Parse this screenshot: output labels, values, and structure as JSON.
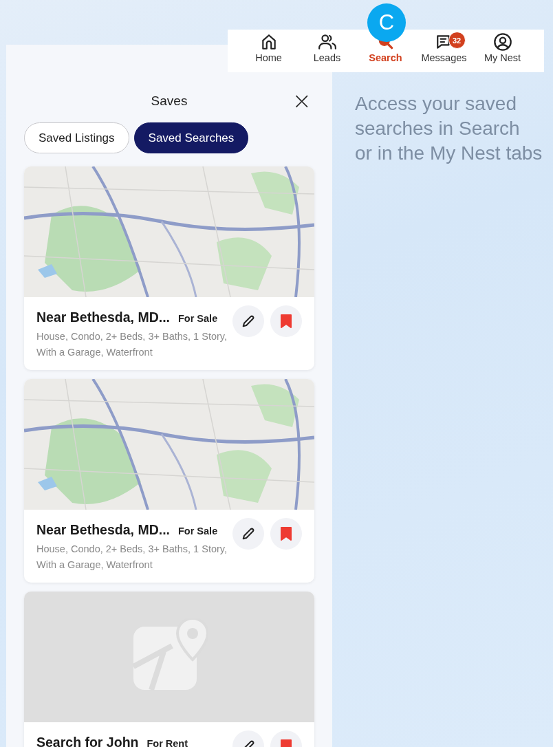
{
  "nav": {
    "items": [
      {
        "label": "Home",
        "selected": false
      },
      {
        "label": "Leads",
        "selected": false
      },
      {
        "label": "Search",
        "selected": true
      },
      {
        "label": "Messages",
        "selected": false,
        "badge": "32"
      },
      {
        "label": "My Nest",
        "selected": false
      }
    ]
  },
  "callout": {
    "marker": "C",
    "lines": [
      "Access your saved",
      "searches in Search",
      "or in the My Nest tabs"
    ]
  },
  "saves": {
    "title": "Saves",
    "close": "×",
    "tabs": [
      {
        "label": "Saved Listings",
        "selected": false
      },
      {
        "label": "Saved Searches",
        "selected": true
      }
    ],
    "cards": [
      {
        "kind": "map",
        "title": "Near Bethesda, MD...",
        "type": "For Sale",
        "description": "House, Condo, 2+ Beds, 3+ Baths, 1 Story, With a Garage, Waterfront",
        "saved": true
      },
      {
        "kind": "map",
        "title": "Near Bethesda, MD...",
        "type": "For Sale",
        "description": "House, Condo, 2+ Beds, 3+ Baths, 1 Story, With a Garage, Waterfront",
        "saved": true
      },
      {
        "kind": "placeholder",
        "title": "Search for John",
        "type": "For Rent",
        "saved": true
      }
    ]
  }
}
